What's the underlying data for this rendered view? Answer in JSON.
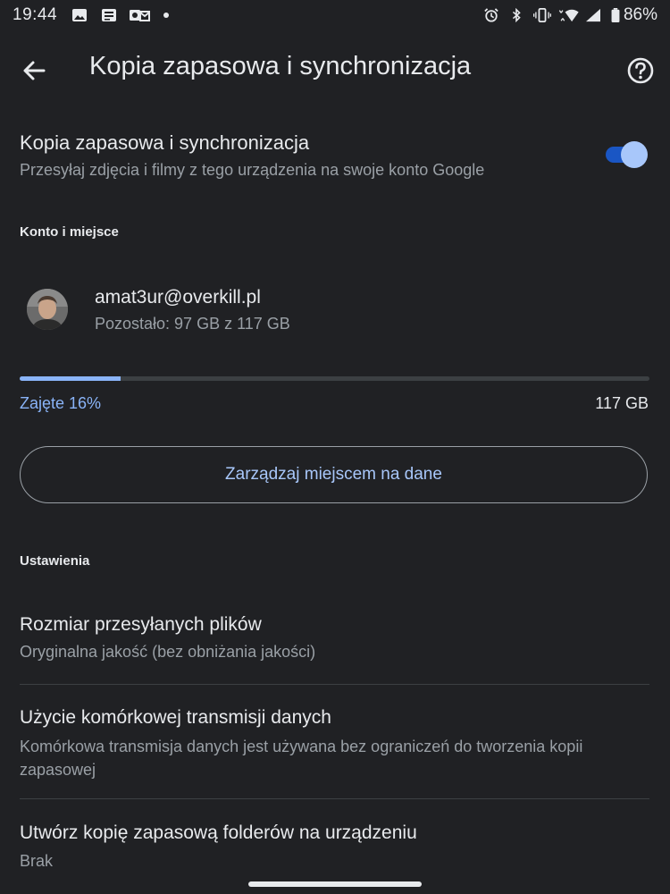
{
  "status_bar": {
    "time": "19:44",
    "battery": "86%",
    "icons": [
      "image-icon",
      "news-icon",
      "outlook-icon",
      "dot-icon",
      "alarm-icon",
      "bluetooth-icon",
      "vibrate-icon",
      "wifi-icon",
      "signal-icon",
      "battery-icon"
    ]
  },
  "app_bar": {
    "title": "Kopia zapasowa i synchronizacja"
  },
  "sync": {
    "title": "Kopia zapasowa i synchronizacja",
    "subtitle": "Przesyłaj zdjęcia i filmy z tego urządzenia na swoje konto Google",
    "enabled": true
  },
  "account_section": {
    "heading": "Konto i miejsce",
    "email": "amat3ur@overkill.pl",
    "remaining": "Pozostało: 97 GB z 117 GB",
    "used_label": "Zajęte 16%",
    "used_fraction": 0.16,
    "total": "117 GB",
    "manage_button": "Zarządzaj miejscem na dane"
  },
  "settings_section": {
    "heading": "Ustawienia",
    "items": [
      {
        "title": "Rozmiar przesyłanych plików",
        "subtitle": "Oryginalna jakość (bez obniżania jakości)"
      },
      {
        "title": "Użycie komórkowej transmisji danych",
        "subtitle": "Komórkowa transmisja danych jest używana bez ograniczeń do tworzenia kopii zapasowej"
      },
      {
        "title": "Utwórz kopię zapasową folderów na urządzeniu",
        "subtitle": "Brak"
      }
    ]
  },
  "colors": {
    "background": "#202124",
    "accent": "#8ab4f8",
    "toggle_track": "#1a56c4"
  }
}
